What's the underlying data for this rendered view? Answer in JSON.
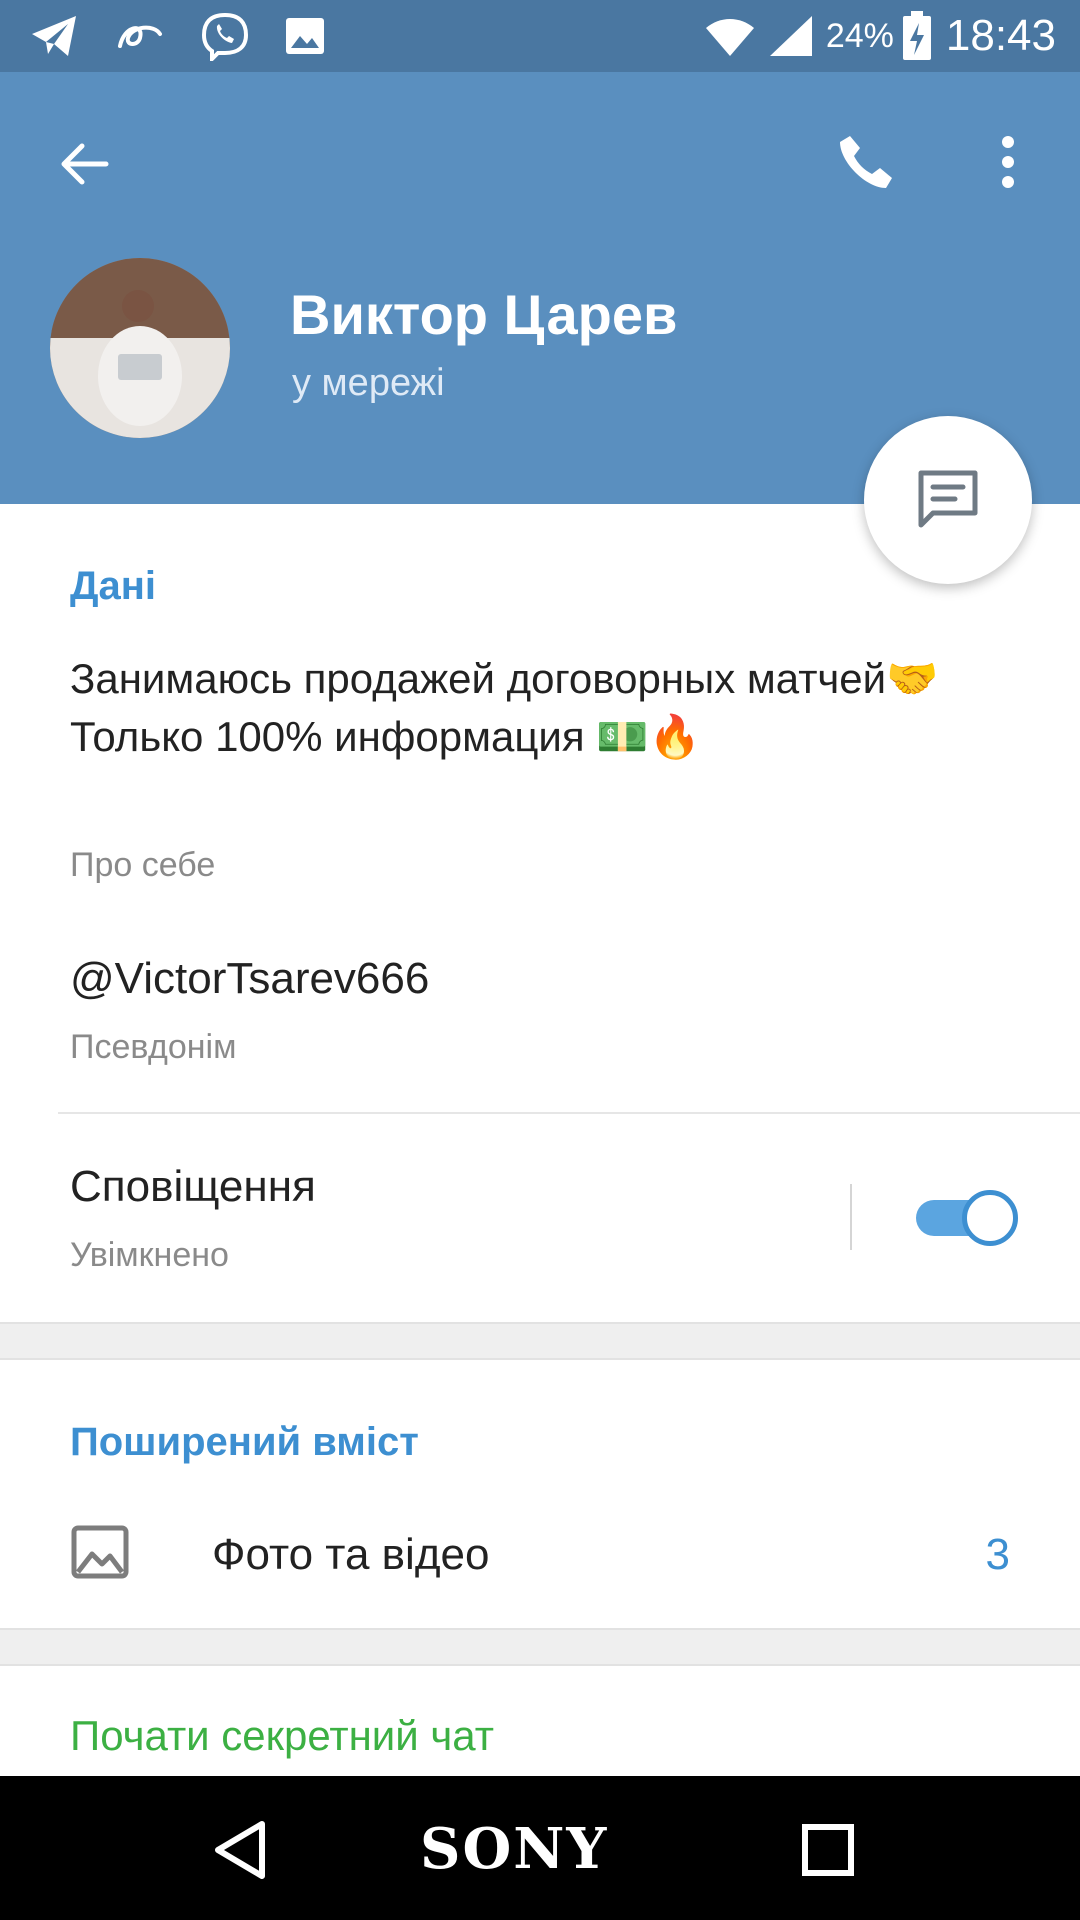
{
  "status_bar": {
    "icons": [
      "telegram-icon",
      "aliexpress-icon",
      "viber-icon",
      "gallery-icon",
      "wifi-icon",
      "signal-icon",
      "battery-charging-icon"
    ],
    "battery": "24%",
    "time": "18:43"
  },
  "header": {
    "name": "Виктор Царев",
    "status": "у мережі"
  },
  "info": {
    "section_title": "Дані",
    "bio": "Занимаюсь продажей договорных матчей🤝 Только 100% информация 💵🔥",
    "bio_label": "Про себе",
    "username": "@VictorTsarev666",
    "username_label": "Псевдонім",
    "notifications": "Сповіщення",
    "notifications_state": "Увімкнено",
    "notifications_on": true
  },
  "shared": {
    "section_title": "Поширений вміст",
    "photos_label": "Фото та відео",
    "photos_count": "3"
  },
  "actions": {
    "secret_chat": "Почати секретний чат"
  },
  "nav": {
    "brand": "SONY"
  },
  "colors": {
    "status_bar": "#4a77a1",
    "header": "#5a8fbf",
    "accent": "#3d8fd1",
    "secret": "#3cb043"
  }
}
